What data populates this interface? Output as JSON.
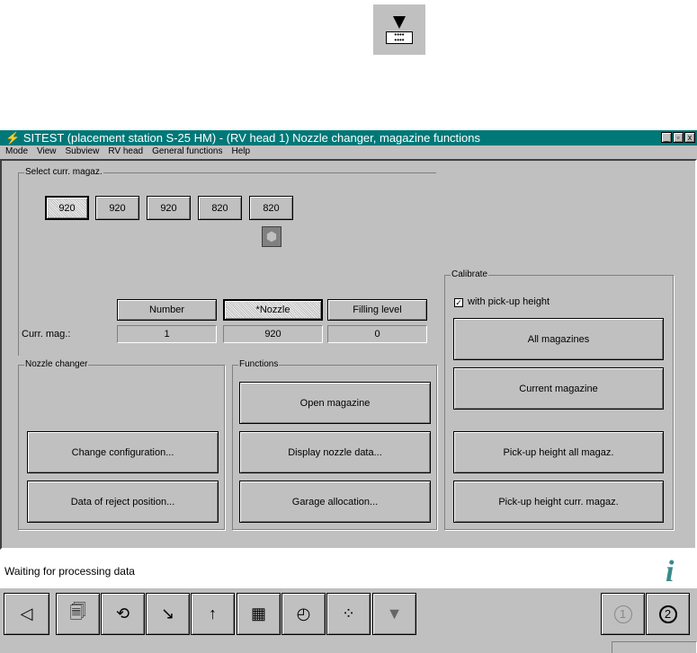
{
  "window": {
    "title": "SITEST (placement station S-25 HM) - (RV head 1) Nozzle changer, magazine functions"
  },
  "menu": [
    "Mode",
    "View",
    "Subview",
    "RV head",
    "General functions",
    "Help"
  ],
  "select_group": {
    "label": "Select curr. magaz.",
    "magazines": [
      "920",
      "920",
      "920",
      "820",
      "820"
    ]
  },
  "table": {
    "headers": [
      "Number",
      "*Nozzle",
      "Filling level"
    ],
    "row_label": "Curr. mag.:",
    "values": [
      "1",
      "920",
      "0"
    ]
  },
  "nozzle_changer": {
    "label": "Nozzle changer",
    "buttons": [
      "Change configuration...",
      "Data of reject position..."
    ]
  },
  "functions": {
    "label": "Functions",
    "buttons": [
      "Open magazine",
      "Display nozzle data...",
      "Garage allocation..."
    ]
  },
  "calibrate": {
    "label": "Calibrate",
    "checkbox_label": "with pick-up height",
    "checked": true,
    "buttons": [
      "All magazines",
      "Current magazine",
      "Pick-up height all magaz.",
      "Pick-up height curr. magaz."
    ]
  },
  "status": {
    "text": "Waiting for processing data"
  },
  "toolbar": {
    "head_buttons": [
      "1",
      "2"
    ]
  }
}
